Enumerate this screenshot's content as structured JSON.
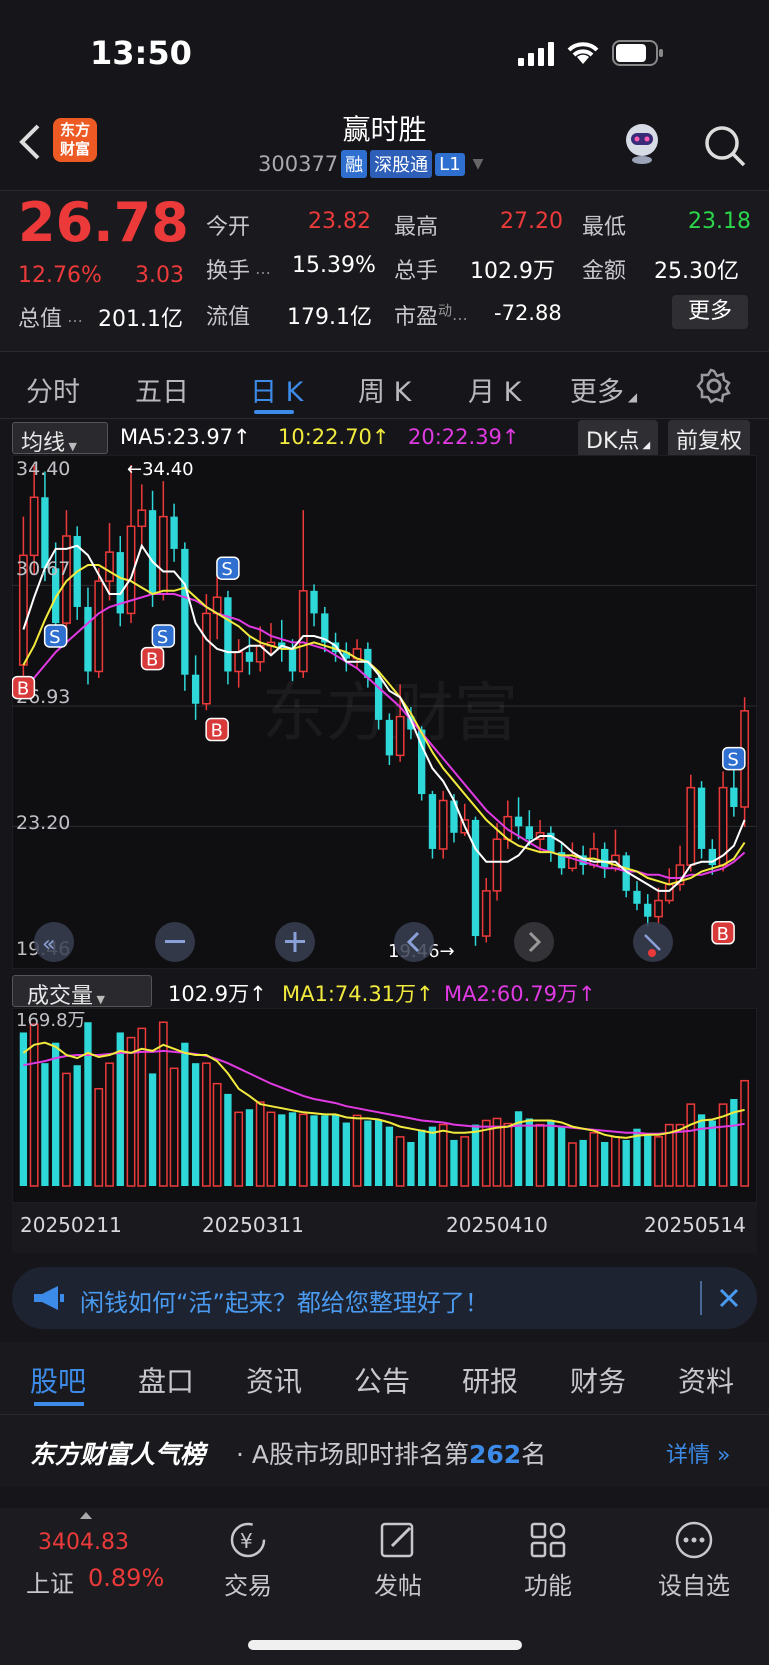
{
  "status": {
    "time": "13:50"
  },
  "header": {
    "logo_line1": "东方",
    "logo_line2": "财富",
    "stock_name": "赢时胜",
    "stock_code": "300377",
    "tags": [
      "融",
      "深股通",
      "L1"
    ]
  },
  "quote": {
    "price": "26.78",
    "change_pct": "12.76%",
    "change": "3.03",
    "total_value_label": "总值",
    "total_value": "201.1亿",
    "fields": [
      {
        "label": "今开",
        "value": "23.82",
        "color": "red"
      },
      {
        "label": "最高",
        "value": "27.20",
        "color": "red"
      },
      {
        "label": "最低",
        "value": "23.18",
        "color": "green"
      },
      {
        "label": "换手",
        "value": "15.39%",
        "color": "white"
      },
      {
        "label": "总手",
        "value": "102.9万",
        "color": "white"
      },
      {
        "label": "金额",
        "value": "25.30亿",
        "color": "white"
      },
      {
        "label": "流值",
        "value": "179.1亿",
        "color": "white"
      },
      {
        "label": "市盈",
        "value": "-72.88",
        "color": "white"
      }
    ],
    "pe_sup": "动",
    "more_button": "更多"
  },
  "ktabs": [
    "分时",
    "五日",
    "日 K",
    "周 K",
    "月 K",
    "更多"
  ],
  "ma_legend": {
    "selector": "均线",
    "ma5": "MA5:23.97",
    "ma10": "10:22.70",
    "ma20": "20:22.39",
    "dk_button": "DK点",
    "adjust_button": "前复权"
  },
  "price_chart": {
    "y_labels": [
      "34.40",
      "30.67",
      "26.93",
      "23.20",
      "19.46"
    ],
    "high_marker": "←34.40",
    "low_marker": "19.46→",
    "watermark": "东方财富",
    "b_marks": [
      "B",
      "B",
      "B",
      "B"
    ],
    "s_marks": [
      "S",
      "S",
      "S",
      "S"
    ]
  },
  "volume": {
    "selector": "成交量",
    "vol": "102.9万",
    "ma1": "MA1:74.31万",
    "ma2": "MA2:60.79万",
    "top_label": "169.8万",
    "dates": [
      "20250211",
      "20250311",
      "20250410",
      "20250514"
    ]
  },
  "banner": {
    "text": "闲钱如何“活”起来？都给您整理好了！"
  },
  "bottom_tabs": [
    "股吧",
    "盘口",
    "资讯",
    "公告",
    "研报",
    "财务",
    "资料"
  ],
  "popular": {
    "brand": "东方财富人气榜",
    "text_prefix": "· A股市场即时排名第",
    "rank": "262",
    "text_suffix": "名",
    "details": "详情"
  },
  "navbar": {
    "index_value": "3404.83",
    "index_name": "上证",
    "index_change": "0.89%",
    "items": [
      "交易",
      "发帖",
      "功能",
      "设自选"
    ]
  },
  "colors": {
    "up": "#ec3a3a",
    "down": "#2fd8d8",
    "ma5": "#ffffff",
    "ma10": "#f2ea3c",
    "ma20": "#e03ae2",
    "accent": "#3c8be8"
  },
  "chart_data": {
    "type": "candlestick",
    "candles": [
      [
        28.2,
        31.6,
        32.8,
        27.6
      ],
      [
        31.6,
        33.4,
        34.4,
        31.0
      ],
      [
        33.4,
        31.2,
        34.2,
        30.8
      ],
      [
        31.2,
        29.5,
        32.0,
        29.0
      ],
      [
        29.5,
        32.2,
        33.0,
        29.2
      ],
      [
        32.2,
        30.0,
        32.5,
        29.6
      ],
      [
        30.0,
        28.0,
        30.6,
        27.6
      ],
      [
        28.0,
        30.8,
        31.2,
        27.8
      ],
      [
        30.8,
        31.7,
        32.6,
        30.2
      ],
      [
        31.7,
        29.8,
        32.2,
        29.4
      ],
      [
        29.8,
        32.5,
        34.4,
        29.5
      ],
      [
        32.5,
        33.0,
        33.8,
        31.8
      ],
      [
        33.0,
        30.4,
        33.6,
        30.0
      ],
      [
        30.4,
        32.8,
        33.9,
        30.2
      ],
      [
        32.8,
        31.8,
        33.2,
        31.4
      ],
      [
        31.8,
        27.9,
        32.0,
        27.4
      ],
      [
        27.9,
        27.0,
        28.5,
        26.5
      ],
      [
        27.0,
        29.8,
        30.4,
        26.8
      ],
      [
        29.8,
        30.3,
        31.0,
        29.0
      ],
      [
        30.3,
        28.0,
        30.5,
        27.6
      ],
      [
        28.0,
        28.6,
        29.0,
        27.5
      ],
      [
        28.6,
        28.3,
        29.1,
        27.9
      ],
      [
        28.3,
        28.8,
        29.4,
        28.0
      ],
      [
        28.8,
        28.9,
        29.5,
        28.5
      ],
      [
        28.9,
        28.7,
        29.6,
        28.3
      ],
      [
        28.7,
        28.0,
        29.0,
        27.7
      ],
      [
        28.0,
        30.5,
        33.0,
        27.8
      ],
      [
        30.5,
        29.8,
        30.7,
        29.4
      ],
      [
        29.8,
        28.9,
        30.0,
        28.6
      ],
      [
        28.9,
        28.6,
        29.2,
        28.3
      ],
      [
        28.6,
        28.4,
        28.9,
        28.0
      ],
      [
        28.4,
        28.7,
        29.0,
        28.1
      ],
      [
        28.7,
        27.8,
        28.9,
        27.5
      ],
      [
        27.8,
        26.5,
        28.0,
        26.2
      ],
      [
        26.5,
        25.4,
        26.7,
        25.1
      ],
      [
        25.4,
        26.6,
        27.6,
        25.2
      ],
      [
        26.6,
        26.2,
        26.9,
        25.9
      ],
      [
        26.2,
        24.2,
        26.3,
        24.0
      ],
      [
        24.2,
        22.5,
        24.3,
        22.2
      ],
      [
        22.5,
        24.0,
        24.3,
        22.2
      ],
      [
        24.0,
        23.0,
        24.2,
        22.7
      ],
      [
        23.0,
        23.4,
        23.9,
        22.9
      ],
      [
        23.4,
        19.8,
        23.5,
        19.5
      ],
      [
        19.8,
        21.2,
        21.6,
        19.6
      ],
      [
        21.2,
        22.8,
        23.3,
        20.9
      ],
      [
        22.8,
        23.5,
        24.0,
        22.5
      ],
      [
        23.5,
        23.2,
        24.1,
        22.8
      ],
      [
        23.2,
        22.8,
        23.7,
        22.6
      ],
      [
        22.8,
        23.0,
        23.4,
        22.4
      ],
      [
        23.0,
        22.4,
        23.2,
        22.1
      ],
      [
        22.4,
        21.9,
        22.7,
        21.7
      ],
      [
        21.9,
        22.3,
        22.7,
        21.8
      ],
      [
        22.3,
        22.0,
        22.6,
        21.7
      ],
      [
        22.0,
        22.5,
        23.0,
        21.9
      ],
      [
        22.5,
        21.9,
        22.7,
        21.6
      ],
      [
        21.9,
        22.3,
        23.1,
        21.8
      ],
      [
        22.3,
        21.2,
        22.4,
        21.0
      ],
      [
        21.2,
        20.8,
        21.5,
        20.6
      ],
      [
        20.8,
        20.4,
        21.1,
        20.1
      ],
      [
        20.4,
        20.9,
        21.3,
        20.2
      ],
      [
        20.9,
        21.4,
        21.9,
        20.8
      ],
      [
        21.4,
        22.0,
        22.6,
        21.2
      ],
      [
        22.0,
        24.4,
        24.8,
        21.8
      ],
      [
        24.4,
        22.5,
        24.6,
        22.2
      ],
      [
        22.5,
        22.0,
        22.8,
        21.7
      ],
      [
        22.0,
        24.4,
        24.9,
        21.8
      ],
      [
        24.4,
        23.8,
        25.0,
        23.5
      ],
      [
        23.8,
        26.78,
        27.2,
        23.18
      ]
    ],
    "ma5": [
      29.3,
      30.3,
      31.2,
      31.8,
      31.8,
      31.9,
      31.6,
      31.0,
      30.4,
      30.4,
      30.9,
      31.9,
      31.4,
      31.1,
      31.1,
      30.7,
      29.5,
      29.0,
      28.7,
      28.6,
      28.6,
      28.8,
      28.8,
      28.5,
      28.8,
      28.7,
      29.1,
      29.1,
      29.0,
      28.8,
      28.3,
      28.3,
      28.3,
      27.9,
      27.4,
      27.2,
      26.5,
      25.7,
      25.0,
      24.6,
      24.0,
      23.2,
      22.5,
      22.1,
      22.1,
      22.1,
      22.3,
      22.7,
      22.9,
      22.9,
      22.7,
      22.4,
      22.2,
      22.1,
      22.1,
      22.1,
      21.8,
      21.6,
      21.4,
      21.2,
      21.2,
      21.5,
      22.0,
      22.1,
      22.1,
      22.3,
      22.6,
      23.4
    ],
    "ma10": [
      28.2,
      28.8,
      29.6,
      30.3,
      30.8,
      31.1,
      31.3,
      31.3,
      31.1,
      30.9,
      30.8,
      30.6,
      30.4,
      30.5,
      30.5,
      30.6,
      30.3,
      30.0,
      29.8,
      29.6,
      29.4,
      29.1,
      28.9,
      28.8,
      28.7,
      28.7,
      28.8,
      28.9,
      28.8,
      28.7,
      28.6,
      28.4,
      28.3,
      28.0,
      27.6,
      27.2,
      26.7,
      26.1,
      25.5,
      25.0,
      24.6,
      24.2,
      23.8,
      23.4,
      23.1,
      22.8,
      22.6,
      22.5,
      22.4,
      22.4,
      22.3,
      22.3,
      22.2,
      22.2,
      22.1,
      22.0,
      21.9,
      21.8,
      21.6,
      21.5,
      21.4,
      21.5,
      21.6,
      21.8,
      21.9,
      22.0,
      22.2,
      22.7
    ],
    "ma20": [
      27.5,
      27.8,
      28.2,
      28.6,
      28.9,
      29.2,
      29.5,
      29.8,
      30.0,
      30.1,
      30.2,
      30.3,
      30.4,
      30.4,
      30.4,
      30.3,
      30.2,
      30.0,
      29.8,
      29.7,
      29.6,
      29.4,
      29.3,
      29.1,
      29.0,
      28.9,
      28.9,
      28.8,
      28.7,
      28.5,
      28.3,
      28.1,
      27.8,
      27.5,
      27.2,
      26.9,
      26.5,
      26.1,
      25.7,
      25.3,
      24.9,
      24.5,
      24.1,
      23.7,
      23.4,
      23.1,
      22.9,
      22.7,
      22.5,
      22.4,
      22.3,
      22.2,
      22.1,
      22.0,
      21.9,
      21.9,
      21.8,
      21.8,
      21.7,
      21.7,
      21.6,
      21.6,
      21.7,
      21.7,
      21.8,
      21.9,
      22.1,
      22.39
    ],
    "volume": [
      150,
      158,
      120,
      140,
      110,
      118,
      160,
      95,
      120,
      150,
      145,
      154,
      110,
      160,
      115,
      140,
      120,
      120,
      100,
      90,
      72,
      75,
      82,
      72,
      70,
      72,
      70,
      69,
      69,
      70,
      62,
      69,
      64,
      65,
      58,
      48,
      43,
      55,
      58,
      60,
      45,
      48,
      60,
      64,
      66,
      61,
      73,
      66,
      60,
      64,
      58,
      42,
      45,
      52,
      43,
      48,
      45,
      56,
      50,
      48,
      60,
      60,
      80,
      70,
      64,
      80,
      85,
      102.9
    ],
    "vol_up": [
      false,
      true,
      false,
      false,
      true,
      false,
      false,
      true,
      true,
      false,
      true,
      true,
      false,
      true,
      true,
      false,
      false,
      true,
      true,
      false,
      true,
      false,
      true,
      true,
      false,
      false,
      true,
      false,
      false,
      false,
      false,
      true,
      false,
      false,
      false,
      true,
      false,
      false,
      false,
      true,
      false,
      true,
      false,
      true,
      true,
      true,
      false,
      false,
      true,
      false,
      false,
      true,
      false,
      true,
      false,
      true,
      false,
      false,
      false,
      true,
      true,
      true,
      true,
      false,
      false,
      true,
      false,
      true
    ],
    "ma1": [
      130,
      138,
      140,
      136,
      128,
      125,
      130,
      126,
      128,
      132,
      130,
      134,
      132,
      138,
      134,
      130,
      128,
      128,
      122,
      110,
      95,
      88,
      80,
      78,
      76,
      74,
      72,
      71,
      70,
      70,
      67,
      66,
      66,
      65,
      62,
      58,
      56,
      54,
      52,
      54,
      52,
      52,
      53,
      55,
      57,
      58,
      62,
      64,
      64,
      64,
      62,
      58,
      56,
      54,
      50,
      48,
      47,
      49,
      50,
      50,
      52,
      55,
      60,
      64,
      65,
      68,
      72,
      74.31
    ],
    "ma2": [
      118,
      120,
      122,
      125,
      127,
      128,
      128,
      128,
      129,
      130,
      130,
      131,
      131,
      132,
      131,
      130,
      129,
      127,
      124,
      120,
      115,
      110,
      105,
      100,
      96,
      92,
      88,
      85,
      83,
      81,
      78,
      76,
      74,
      72,
      70,
      68,
      66,
      64,
      63,
      62,
      60,
      59,
      58,
      58,
      58,
      58,
      59,
      59,
      59,
      59,
      58,
      57,
      56,
      55,
      54,
      53,
      52,
      52,
      51,
      51,
      52,
      53,
      54,
      56,
      57,
      58,
      59,
      60.79
    ],
    "ylim": [
      19.46,
      34.4
    ]
  }
}
